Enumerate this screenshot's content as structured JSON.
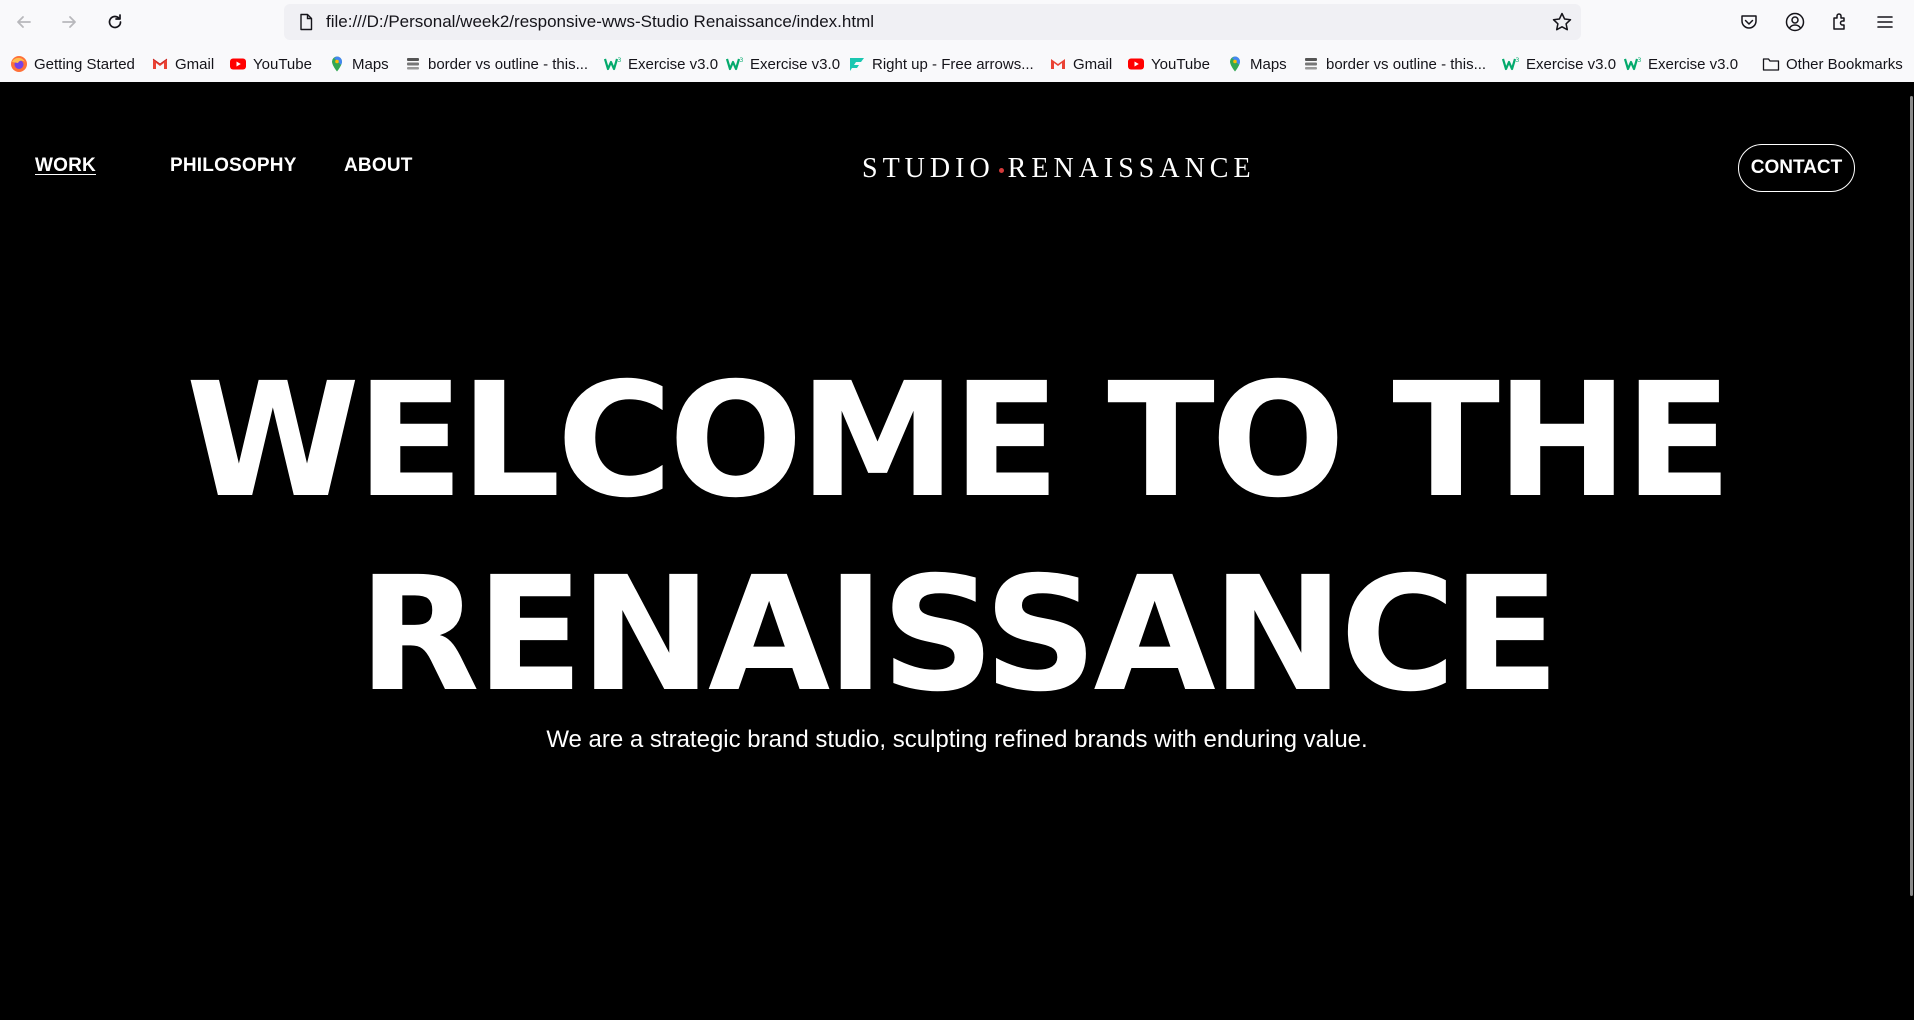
{
  "browser": {
    "url": "file:///D:/Personal/week2/responsive-wws-Studio Renaissance/index.html",
    "toolbar_icons": [
      "back-icon",
      "forward-icon",
      "reload-icon",
      "page-icon",
      "bookmark-star-icon",
      "pocket-icon",
      "account-icon",
      "extensions-icon",
      "menu-icon"
    ],
    "bookmarks": [
      {
        "label": "Getting Started",
        "icon": "firefox-icon"
      },
      {
        "label": "Gmail",
        "icon": "gmail-icon"
      },
      {
        "label": "YouTube",
        "icon": "youtube-icon"
      },
      {
        "label": "Maps",
        "icon": "maps-icon"
      },
      {
        "label": "border vs outline - this...",
        "icon": "stackexchange-icon"
      },
      {
        "label": "Exercise v3.0",
        "icon": "w3schools-icon"
      },
      {
        "label": "Exercise v3.0",
        "icon": "w3schools-icon"
      },
      {
        "label": "Right up - Free arrows...",
        "icon": "flaticon-icon"
      },
      {
        "label": "Gmail",
        "icon": "gmail-icon"
      },
      {
        "label": "YouTube",
        "icon": "youtube-icon"
      },
      {
        "label": "Maps",
        "icon": "maps-icon"
      },
      {
        "label": "border vs outline - this...",
        "icon": "stackexchange-icon"
      },
      {
        "label": "Exercise v3.0",
        "icon": "w3schools-icon"
      },
      {
        "label": "Exercise v3.0",
        "icon": "w3schools-icon"
      }
    ],
    "other_bookmarks": "Other Bookmarks"
  },
  "site": {
    "nav": {
      "work": "WORK",
      "philosophy": "PHILOSOPHY",
      "about": "ABOUT"
    },
    "logo": {
      "left": "STUDIO",
      "right": "RENAISSANCE",
      "dot_color": "#d33a3a"
    },
    "contact": "CONTACT",
    "hero": {
      "line1": "WELCOME TO THE",
      "line2": "RENAISSANCE"
    },
    "tagline": "We are a strategic brand studio, sculpting refined brands with enduring value."
  },
  "colors": {
    "page_background": "#000000",
    "text": "#ffffff",
    "chrome_background": "#f9f9fb",
    "urlbar_background": "#f0f0f4"
  }
}
